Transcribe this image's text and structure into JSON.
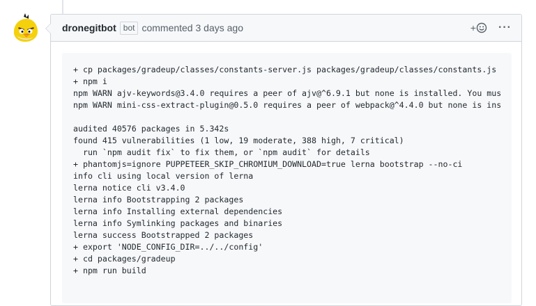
{
  "comment": {
    "author": "dronegitbot",
    "badge": "bot",
    "action": "commented",
    "timestamp": "3 days ago",
    "reaction_label": "+",
    "reaction_icon": "smiley-icon",
    "more_label": "···"
  },
  "code_lines": [
    "+ cp packages/gradeup/classes/constants-server.js packages/gradeup/classes/constants.js",
    "+ npm i",
    "npm WARN ajv-keywords@3.4.0 requires a peer of ajv@^6.9.1 but none is installed. You mus",
    "npm WARN mini-css-extract-plugin@0.5.0 requires a peer of webpack@^4.4.0 but none is ins",
    "",
    "audited 40576 packages in 5.342s",
    "found 415 vulnerabilities (1 low, 19 moderate, 388 high, 7 critical)",
    "  run `npm audit fix` to fix them, or `npm audit` for details",
    "+ phantomjs=ignore PUPPETEER_SKIP_CHROMIUM_DOWNLOAD=true lerna bootstrap --no-ci",
    "info cli using local version of lerna",
    "lerna notice cli v3.4.0",
    "lerna info Bootstrapping 2 packages",
    "lerna info Installing external dependencies",
    "lerna info Symlinking packages and binaries",
    "lerna success Bootstrapped 2 packages",
    "+ export 'NODE_CONFIG_DIR=../../config'",
    "+ cd packages/gradeup",
    "+ npm run build"
  ],
  "colors": {
    "header_bg": "#f6f8fa",
    "border": "#d1d5da",
    "text": "#24292e",
    "muted": "#586069",
    "avatar_yellow": "#f5d10c"
  }
}
